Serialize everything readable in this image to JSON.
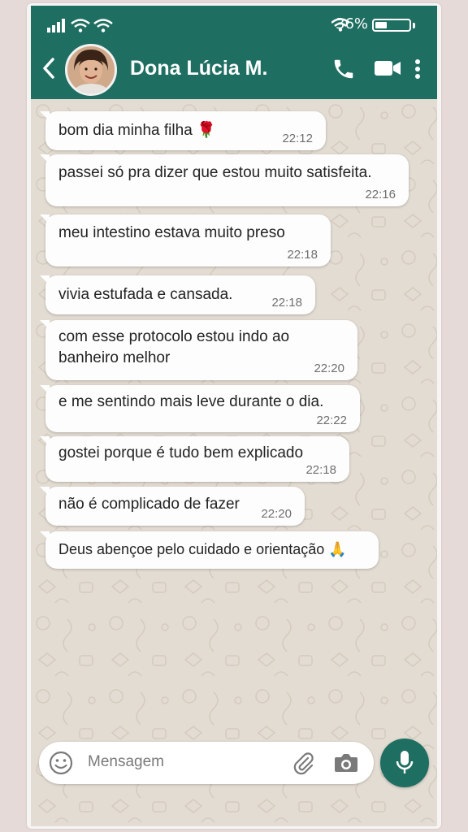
{
  "status": {
    "battery_text": "36%",
    "battery_level": 0.36
  },
  "header": {
    "contact_name": "Dona Lúcia M."
  },
  "messages": [
    {
      "text": "bom dia minha filha 🌹",
      "time": "22:12"
    },
    {
      "text": "passei só pra dizer que estou muito satisfeita.",
      "time": "22:16"
    },
    {
      "text": "meu intestino estava muito preso",
      "time": "22:18"
    },
    {
      "text": "vivia estufada e cansada.",
      "time": "22:18"
    },
    {
      "text": "com esse protocolo estou indo ao banheiro melhor",
      "time": "22:20"
    },
    {
      "text": "e me sentindo mais leve durante o dia.",
      "time": "22:22"
    },
    {
      "text": "gostei porque é tudo bem explicado",
      "time": "22:18"
    },
    {
      "text": "não é complicado de fazer",
      "time": "22:20"
    },
    {
      "text": "Deus abençoe pelo cuidado e orientação 🙏",
      "time": ""
    }
  ],
  "composer": {
    "placeholder": "Mensagem"
  },
  "colors": {
    "header": "#1f6e62",
    "bubble": "#fdfdfd",
    "chat_bg": "#e3dcd2"
  }
}
